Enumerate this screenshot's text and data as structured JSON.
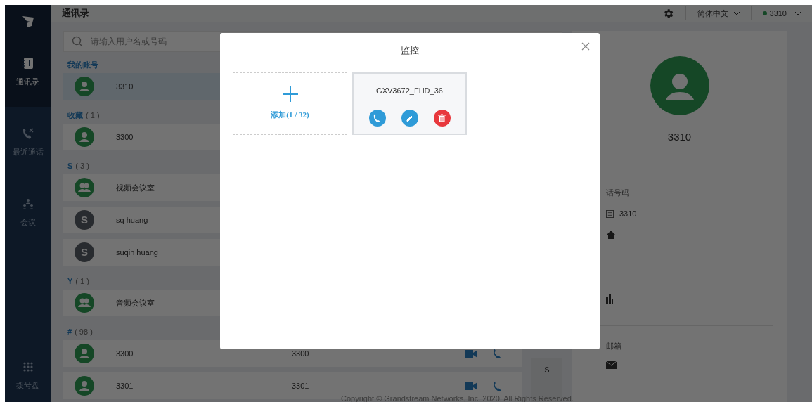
{
  "sidebar": {
    "items": [
      {
        "label": "通讯录",
        "selected": true
      },
      {
        "label": "最近通话",
        "selected": false
      },
      {
        "label": "会议",
        "selected": false
      }
    ],
    "bottom_item": {
      "label": "拨号盘",
      "selected": false
    }
  },
  "header": {
    "title": "通讯录",
    "language": "简体中文",
    "account": "3310"
  },
  "search": {
    "placeholder": "请输入用户名或号码"
  },
  "sections": [
    {
      "label": "我的账号",
      "contacts": [
        {
          "name": "3310",
          "kind": "person",
          "selected": true
        }
      ]
    },
    {
      "label": "收藏",
      "count": "( 1 )",
      "contacts": [
        {
          "name": "3300",
          "kind": "person",
          "selected": false
        }
      ]
    },
    {
      "label": "S",
      "count": "( 3 )",
      "contacts": [
        {
          "name": "视频会议室",
          "kind": "group",
          "selected": false
        },
        {
          "name": "sq huang",
          "kind": "letter",
          "initial": "S",
          "selected": false
        },
        {
          "name": "suqin huang",
          "kind": "letter",
          "initial": "S",
          "selected": false
        }
      ]
    },
    {
      "label": "Y",
      "count": "( 1 )",
      "contacts": [
        {
          "name": "音频会议室",
          "kind": "group",
          "selected": false
        }
      ]
    },
    {
      "label": "#",
      "count": "( 98 )",
      "contacts": [
        {
          "name": "3300",
          "number": "3300",
          "kind": "person",
          "selected": false
        },
        {
          "name": "3301",
          "number": "3301",
          "kind": "person",
          "selected": false
        }
      ]
    }
  ],
  "index": {
    "letters": [
      "S"
    ]
  },
  "detail": {
    "name": "3310",
    "phone_label": "话号码",
    "phone": "3310",
    "email_label": "邮箱"
  },
  "footer": {
    "copyright": "Copyright © Grandstream Networks, Inc. 2020. All Rights Reserved."
  },
  "dialog": {
    "title": "监控",
    "add_label": "添加(1 / 32)",
    "devices": [
      {
        "name": "GXV3672_FHD_36"
      }
    ]
  }
}
